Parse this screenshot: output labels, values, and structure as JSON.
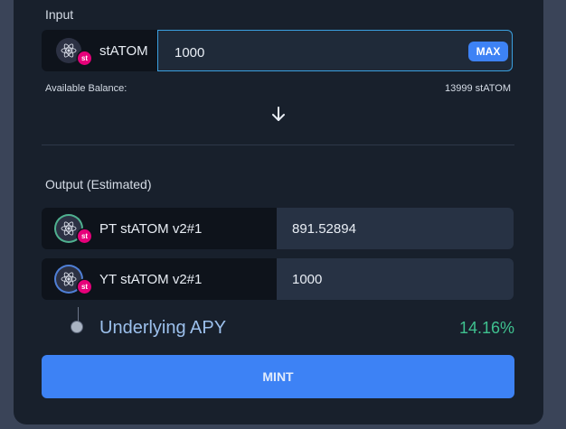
{
  "input": {
    "label": "Input",
    "token": "stATOM",
    "badge": "st",
    "value": "1000",
    "max_label": "MAX",
    "available_label": "Available Balance:",
    "available_value": "13999 stATOM"
  },
  "output": {
    "label": "Output (Estimated)",
    "rows": [
      {
        "token": "PT stATOM v2#1",
        "badge": "st",
        "value": "891.52894"
      },
      {
        "token": "YT stATOM v2#1",
        "badge": "st",
        "value": "1000"
      }
    ]
  },
  "apy": {
    "label": "Underlying APY",
    "value": "14.16%"
  },
  "mint_label": "MINT",
  "colors": {
    "accent": "#3d82f5",
    "apy_green": "#3fc18f",
    "badge_pink": "#e6007a",
    "card_bg": "#18202c"
  }
}
